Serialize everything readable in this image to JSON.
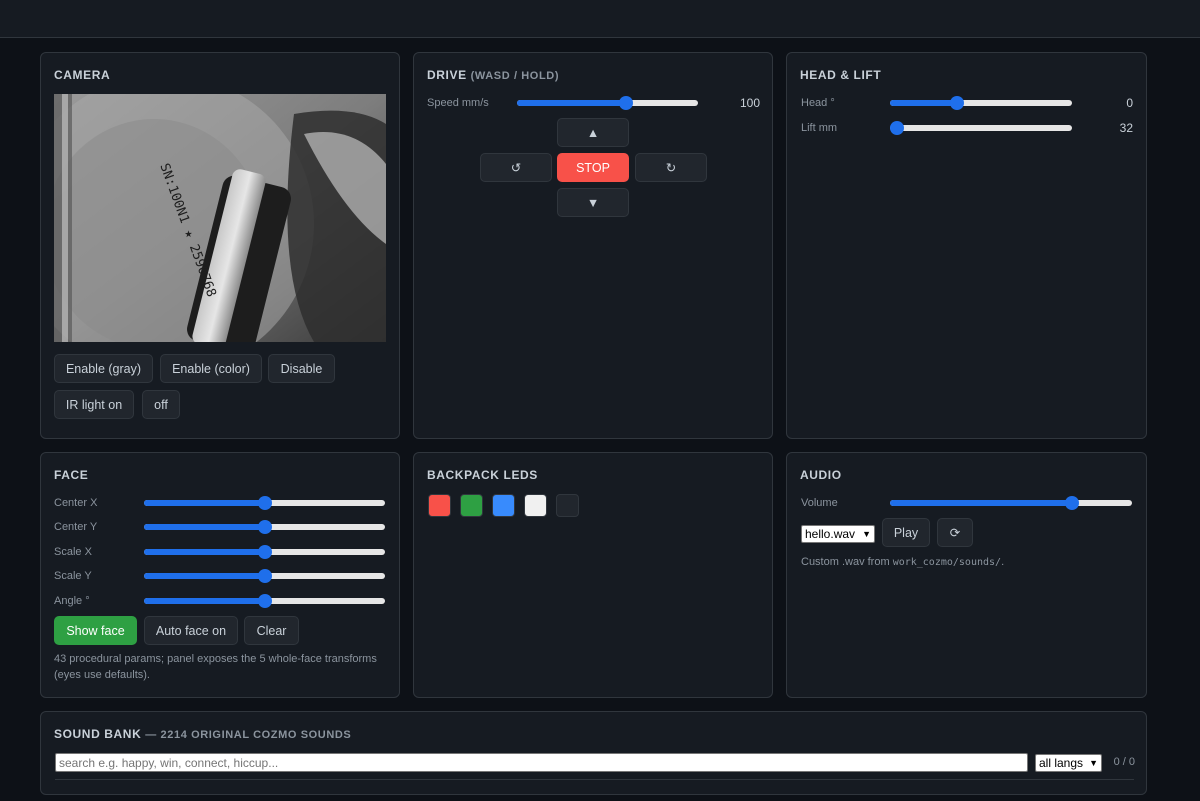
{
  "camera": {
    "title": "CAMERA",
    "buttons": [
      "Enable (gray)",
      "Enable (color)",
      "Disable",
      "IR light on",
      "off"
    ],
    "feed_text": "SN:100N1 ★ 2590768"
  },
  "drive": {
    "title": "DRIVE",
    "subtitle": "(WASD / HOLD)",
    "speed_label": "Speed mm/s",
    "speed_value": "100",
    "speed_fraction": 0.6,
    "forward_icon": "▲",
    "back_icon": "▼",
    "rotate_left_icon": "↺",
    "rotate_right_icon": "↻",
    "stop_label": "STOP"
  },
  "headlift": {
    "title": "HEAD & LIFT",
    "head_label": "Head °",
    "head_value": "0",
    "head_fraction": 0.37,
    "lift_label": "Lift mm",
    "lift_value": "32",
    "lift_fraction": 0.0
  },
  "face": {
    "title": "FACE",
    "params": [
      {
        "label": "Center X",
        "fraction": 0.5
      },
      {
        "label": "Center Y",
        "fraction": 0.5
      },
      {
        "label": "Scale X",
        "fraction": 0.5
      },
      {
        "label": "Scale Y",
        "fraction": 0.5
      },
      {
        "label": "Angle °",
        "fraction": 0.5
      }
    ],
    "show_label": "Show face",
    "auto_label": "Auto face on",
    "clear_label": "Clear",
    "note": "43 procedural params; panel exposes the 5 whole-face transforms (eyes use defaults)."
  },
  "leds": {
    "title": "BACKPACK LEDS",
    "colors": [
      "#f85149",
      "#2ea043",
      "#388bfd",
      "#f0f0f0",
      "#21262d"
    ]
  },
  "audio": {
    "title": "AUDIO",
    "volume_label": "Volume",
    "volume_fraction": 0.75,
    "file_selected": "hello.wav",
    "play_label": "Play",
    "refresh_icon": "⟳",
    "note_prefix": "Custom .wav from ",
    "note_code": "work_cozmo/sounds/",
    "note_suffix": "."
  },
  "soundbank": {
    "title": "SOUND BANK",
    "subtitle": "— 2214 ORIGINAL COZMO SOUNDS",
    "search_placeholder": "search e.g. happy, win, connect, hiccup...",
    "lang_selected": "all langs",
    "count": "0 / 0"
  },
  "colors": {
    "accent": "#1f6feb",
    "danger": "#f85149",
    "success": "#2ea043"
  }
}
